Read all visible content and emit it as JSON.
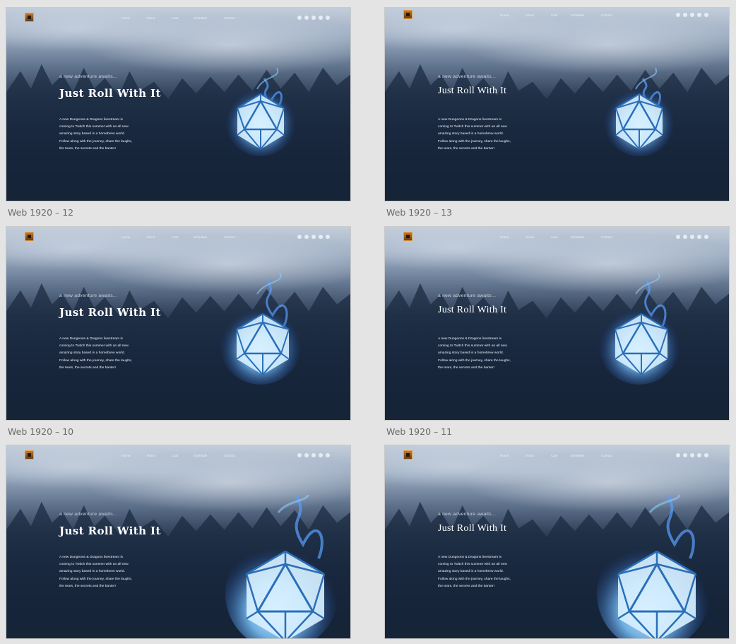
{
  "page": {
    "nav_items": [
      "Home",
      "About",
      "Cast",
      "Schedule",
      "Contact"
    ],
    "kicker": "a new adventure awaits...",
    "title": "Just Roll With It",
    "description_lines": [
      "A new Dungeons & Dragons livestream is",
      "coming to Twitch this summer with an all new",
      "amazing story based in a homebrew world.",
      "Follow along with the journey, share the laughs,",
      "the tears, the secrets and the banter!"
    ],
    "social_icons": [
      "discord-icon",
      "youtube-icon",
      "instagram-icon",
      "twitter-icon",
      "facebook-icon"
    ]
  },
  "artboards": [
    {
      "label": "Web 1920 – 12"
    },
    {
      "label": "Web 1920 – 13"
    },
    {
      "label": "Web 1920 – 10"
    },
    {
      "label": "Web 1920 – 11"
    },
    {
      "label": ""
    },
    {
      "label": ""
    }
  ],
  "colors": {
    "canvas_background": "#e4e4e4",
    "dice_glow": "#7ec8ff",
    "dice_flame": "#2f6fe0"
  }
}
